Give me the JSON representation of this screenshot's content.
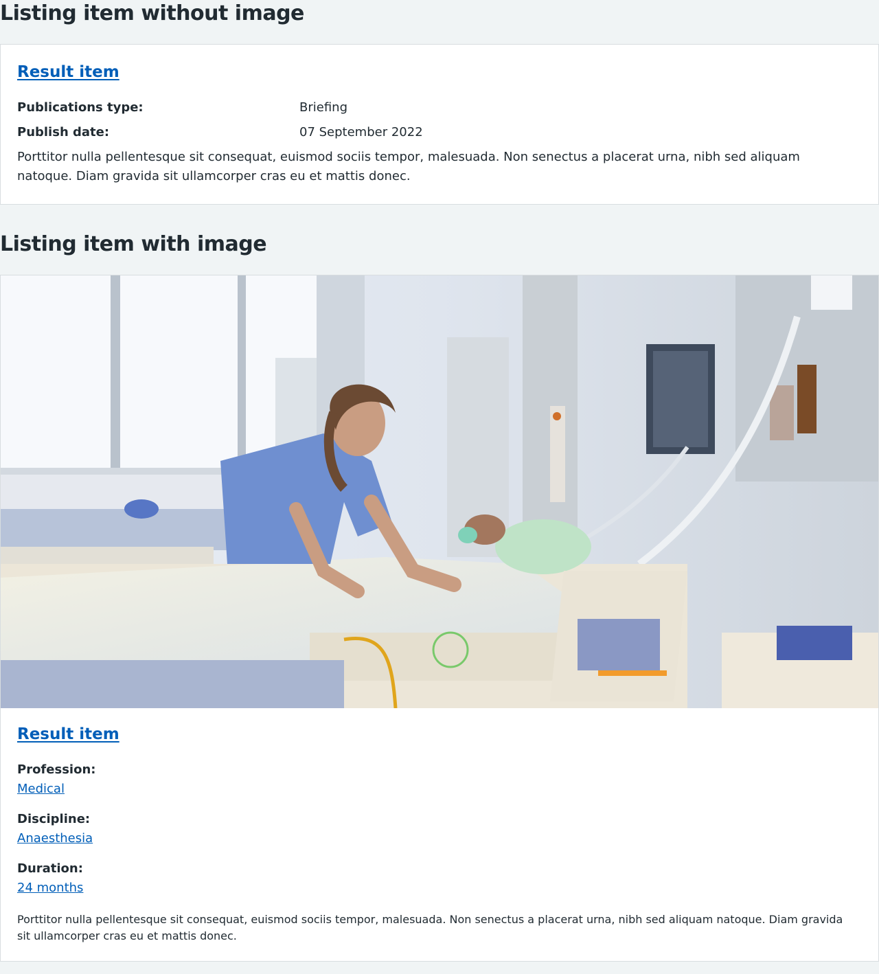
{
  "headings": {
    "without_image": "Listing item without image",
    "with_image": "Listing item with image"
  },
  "card1": {
    "title": "Result item",
    "meta": [
      {
        "label": "Publications type:",
        "value": "Briefing"
      },
      {
        "label": "Publish date:",
        "value": "07 September 2022"
      }
    ],
    "description": "Porttitor nulla pellentesque sit consequat, euismod sociis tempor, malesuada. Non senectus a placerat urna, nibh sed aliquam natoque. Diam gravida sit ullamcorper cras eu et mattis donec."
  },
  "card2": {
    "title": "Result item",
    "fields": [
      {
        "label": "Profession:",
        "value": "Medical"
      },
      {
        "label": "Discipline:",
        "value": "Anaesthesia"
      },
      {
        "label": "Duration:",
        "value": "24 months"
      }
    ],
    "description": "Porttitor nulla pellentesque sit consequat, euismod sociis tempor, malesuada. Non senectus a placerat urna, nibh sed aliquam natoque. Diam gravida sit ullamcorper cras eu et mattis donec."
  },
  "colors": {
    "page_background": "#f0f4f5",
    "link": "#005eb8",
    "text": "#212b32",
    "card_border": "#d8dde0"
  }
}
